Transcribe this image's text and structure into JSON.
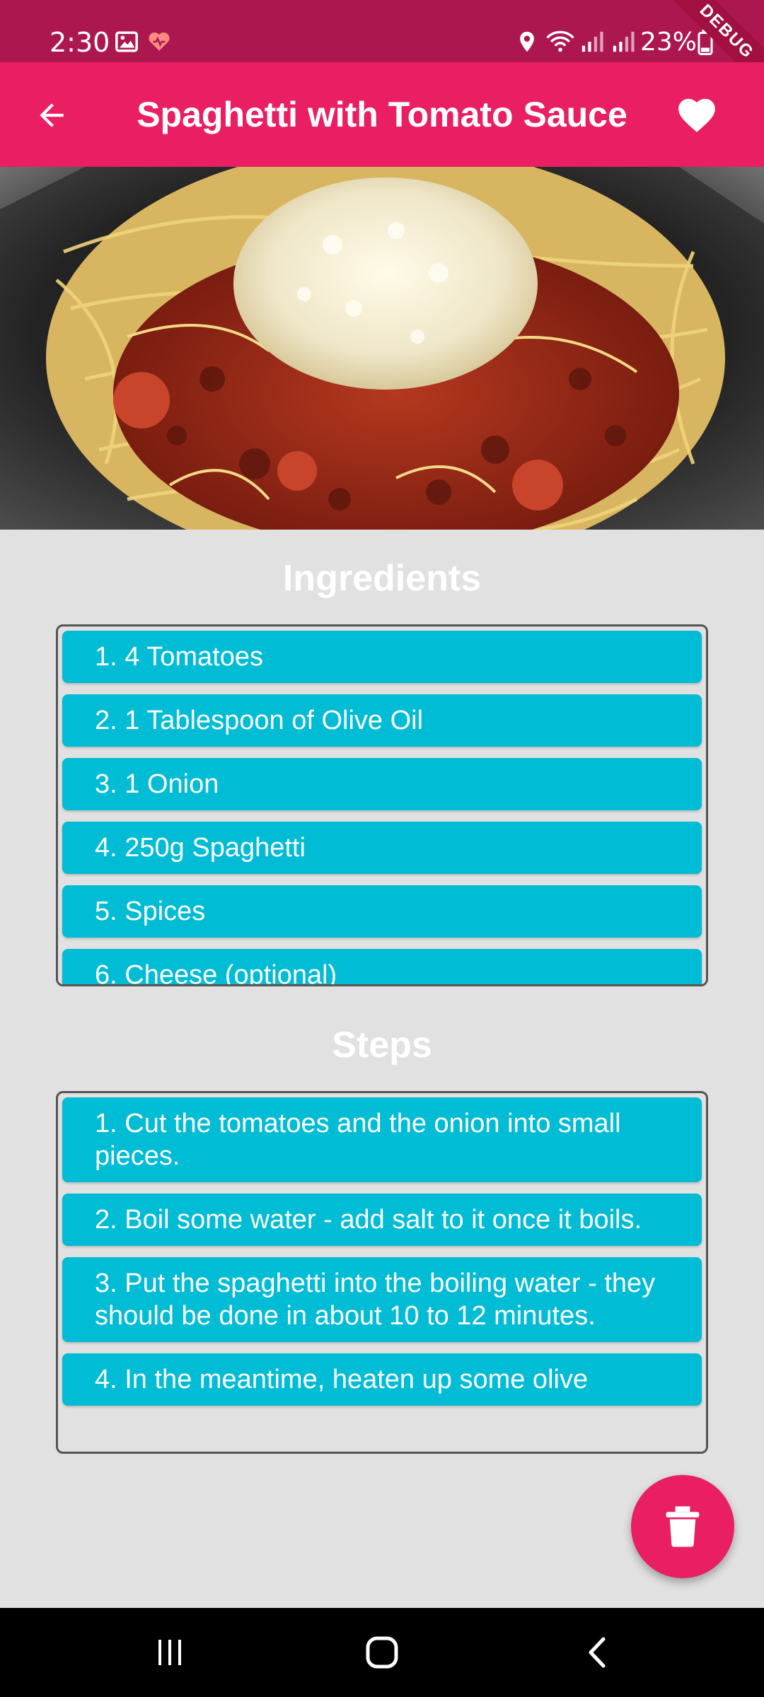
{
  "status_bar": {
    "time": "2:30",
    "battery": "23%",
    "debug_label": "DEBUG",
    "icons": [
      "gallery-icon",
      "health-icon",
      "location-icon",
      "wifi-icon",
      "signal-icon",
      "signal-icon",
      "battery-icon"
    ]
  },
  "app_bar": {
    "title": "Spaghetti with Tomato Sauce",
    "back_icon": "arrow-back-icon",
    "favorite_icon": "heart-icon"
  },
  "ingredients": {
    "title": "Ingredients",
    "items": [
      "1. 4 Tomatoes",
      "2. 1 Tablespoon of Olive Oil",
      "3. 1 Onion",
      "4. 250g Spaghetti",
      "5. Spices",
      "6. Cheese (optional)"
    ]
  },
  "steps": {
    "title": "Steps",
    "items": [
      "1. Cut the tomatoes and the onion into small pieces.",
      "2. Boil some water - add salt to it once it boils.",
      "3. Put the spaghetti into the boiling water - they should be done in about 10 to 12 minutes.",
      "4. In the meantime, heaten up some olive"
    ]
  },
  "fab": {
    "icon": "trash-icon"
  },
  "colors": {
    "primary": "#e91e63",
    "status_bar": "#ad1750",
    "list_item": "#00bcd4",
    "background": "#e1e1e1"
  }
}
